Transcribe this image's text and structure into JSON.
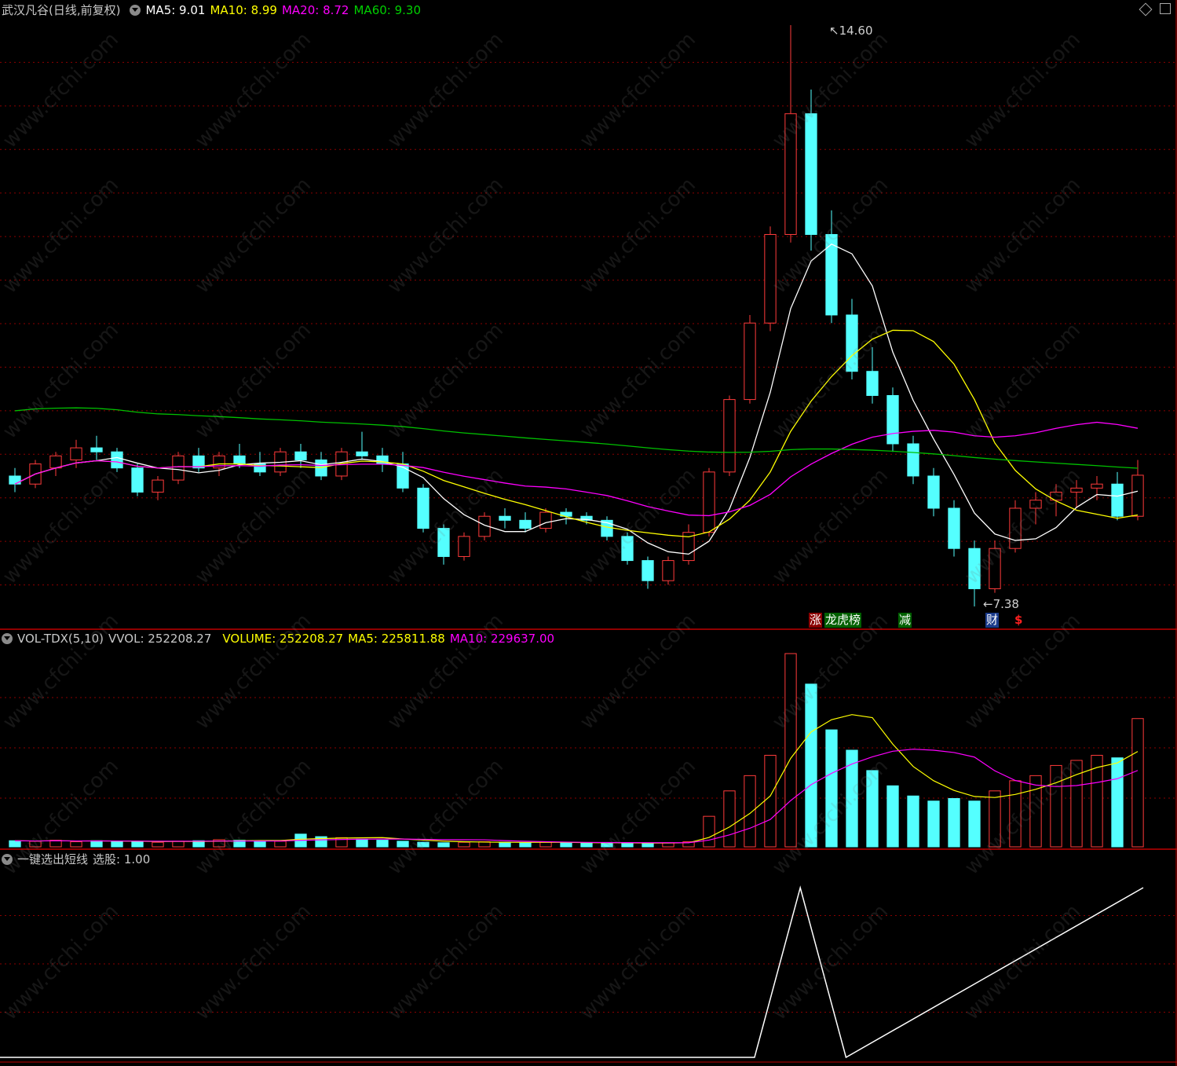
{
  "main_header": {
    "title": "武汉凡谷(日线,前复权)",
    "ma5": "MA5: 9.01",
    "ma10": "MA10: 8.99",
    "ma20": "MA20: 8.72",
    "ma60": "MA60: 9.30"
  },
  "vol_header": {
    "title": "VOL-TDX(5,10)",
    "vvol": "VVOL: 252208.27",
    "volume": "VOLUME: 252208.27",
    "ma5": "MA5: 225811.88",
    "ma10": "MA10: 229637.00"
  },
  "signal_header": {
    "title": "一键选出短线",
    "value": "选股: 1.00"
  },
  "markers": {
    "high_label": "14.60",
    "low_label": "7.38",
    "tag_rise": "涨",
    "tag_rank": "龙虎榜",
    "tag_reduce": "减",
    "tag_finance": "财",
    "tag_dollar": "$"
  },
  "watermark": "www.cfchi.com",
  "colors": {
    "up": "#ff3b3b",
    "down": "#54ffff",
    "ma5": "#ffffff",
    "ma10": "#ffff00",
    "ma20": "#ff00ff",
    "ma60": "#00c000",
    "grid": "#8b0000",
    "divider": "#c00000"
  },
  "chart_data": {
    "type": "candlestick",
    "y_range": [
      7.38,
      14.6
    ],
    "high": 14.6,
    "low": 7.38,
    "ohlc_approx": [
      [
        9.0,
        9.1,
        8.8,
        8.9
      ],
      [
        8.9,
        9.2,
        8.85,
        9.15
      ],
      [
        9.1,
        9.3,
        9.0,
        9.25
      ],
      [
        9.2,
        9.45,
        9.1,
        9.35
      ],
      [
        9.35,
        9.5,
        9.2,
        9.3
      ],
      [
        9.3,
        9.35,
        9.05,
        9.1
      ],
      [
        9.1,
        9.15,
        8.75,
        8.8
      ],
      [
        8.8,
        9.0,
        8.7,
        8.95
      ],
      [
        8.95,
        9.3,
        8.9,
        9.25
      ],
      [
        9.25,
        9.35,
        9.05,
        9.1
      ],
      [
        9.1,
        9.3,
        9.0,
        9.25
      ],
      [
        9.25,
        9.4,
        9.1,
        9.15
      ],
      [
        9.15,
        9.3,
        9.0,
        9.05
      ],
      [
        9.05,
        9.35,
        9.0,
        9.3
      ],
      [
        9.3,
        9.4,
        9.1,
        9.2
      ],
      [
        9.2,
        9.3,
        8.95,
        9.0
      ],
      [
        9.0,
        9.35,
        8.95,
        9.3
      ],
      [
        9.3,
        9.55,
        9.2,
        9.25
      ],
      [
        9.25,
        9.35,
        9.05,
        9.15
      ],
      [
        9.15,
        9.3,
        8.8,
        8.85
      ],
      [
        8.85,
        8.9,
        8.3,
        8.35
      ],
      [
        8.35,
        8.4,
        7.9,
        8.0
      ],
      [
        8.0,
        8.3,
        7.95,
        8.25
      ],
      [
        8.25,
        8.55,
        8.2,
        8.5
      ],
      [
        8.5,
        8.6,
        8.35,
        8.45
      ],
      [
        8.45,
        8.55,
        8.3,
        8.35
      ],
      [
        8.35,
        8.6,
        8.3,
        8.55
      ],
      [
        8.55,
        8.6,
        8.4,
        8.5
      ],
      [
        8.5,
        8.55,
        8.4,
        8.45
      ],
      [
        8.45,
        8.5,
        8.2,
        8.25
      ],
      [
        8.25,
        8.3,
        7.9,
        7.95
      ],
      [
        7.95,
        8.0,
        7.6,
        7.7
      ],
      [
        7.7,
        8.0,
        7.65,
        7.95
      ],
      [
        7.95,
        8.4,
        7.9,
        8.3
      ],
      [
        8.3,
        9.1,
        8.25,
        9.05
      ],
      [
        9.05,
        10.0,
        9.0,
        9.95
      ],
      [
        9.95,
        11.0,
        9.9,
        10.9
      ],
      [
        10.9,
        12.1,
        10.8,
        12.0
      ],
      [
        12.0,
        14.6,
        11.9,
        13.5
      ],
      [
        13.5,
        13.8,
        11.8,
        12.0
      ],
      [
        12.0,
        12.3,
        10.9,
        11.0
      ],
      [
        11.0,
        11.2,
        10.2,
        10.3
      ],
      [
        10.3,
        10.6,
        9.9,
        10.0
      ],
      [
        10.0,
        10.1,
        9.3,
        9.4
      ],
      [
        9.4,
        9.5,
        8.9,
        9.0
      ],
      [
        9.0,
        9.1,
        8.5,
        8.6
      ],
      [
        8.6,
        8.7,
        8.0,
        8.1
      ],
      [
        8.1,
        8.2,
        7.38,
        7.6
      ],
      [
        7.6,
        8.2,
        7.55,
        8.1
      ],
      [
        8.1,
        8.7,
        8.05,
        8.6
      ],
      [
        8.6,
        8.8,
        8.4,
        8.7
      ],
      [
        8.7,
        8.9,
        8.5,
        8.8
      ],
      [
        8.8,
        8.95,
        8.6,
        8.85
      ],
      [
        8.85,
        9.0,
        8.7,
        8.9
      ],
      [
        8.9,
        9.05,
        8.45,
        8.5
      ],
      [
        8.5,
        9.2,
        8.45,
        9.01
      ]
    ],
    "volume_approx": [
      12000,
      11000,
      13000,
      10000,
      12000,
      11000,
      10000,
      9000,
      11000,
      12000,
      14000,
      13000,
      12000,
      11000,
      25000,
      20000,
      18000,
      15000,
      13000,
      11000,
      9000,
      8000,
      9000,
      10000,
      9000,
      8000,
      9000,
      8000,
      7000,
      8000,
      7000,
      7000,
      8000,
      10000,
      60000,
      110000,
      140000,
      180000,
      380000,
      320000,
      230000,
      190000,
      150000,
      120000,
      100000,
      90000,
      95000,
      90000,
      110000,
      130000,
      140000,
      160000,
      170000,
      180000,
      175000,
      252208.27
    ],
    "signal": {
      "x_rel": [
        0,
        0.66,
        0.7,
        0.74,
        1.0
      ],
      "y": [
        0,
        0,
        1,
        0,
        1
      ]
    }
  }
}
